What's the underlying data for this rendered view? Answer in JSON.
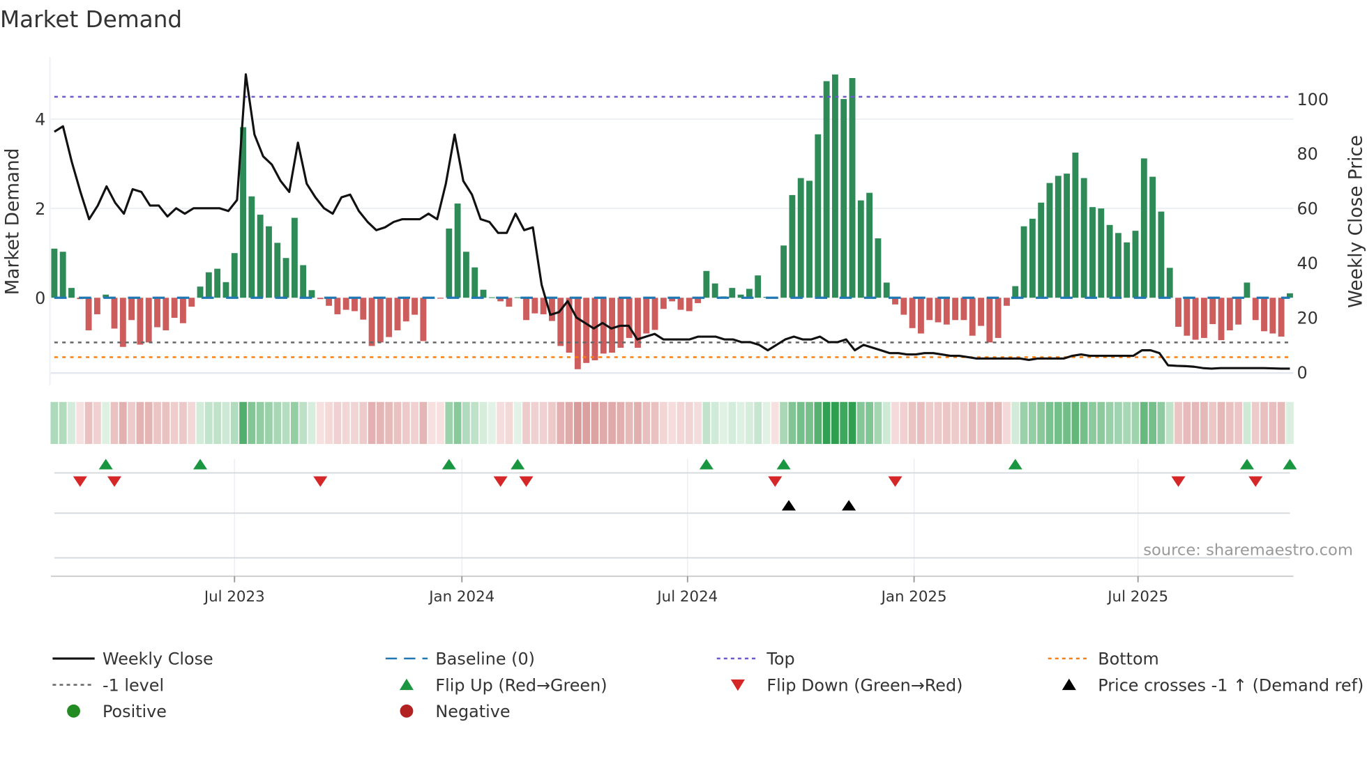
{
  "chart_data": {
    "type": "bar",
    "title": "Market Demand",
    "ylabel": "Market Demand",
    "y2label": "Weekly Close Price",
    "ylim": [
      -1.75,
      5.2
    ],
    "y2lim": [
      0,
      107
    ],
    "yticks": [
      "0",
      "2",
      "4"
    ],
    "y2ticks": [
      "0",
      "20",
      "40",
      "60",
      "80",
      "100"
    ],
    "xticks": [
      "Jul 2023",
      "Jan 2024",
      "Jul 2024",
      "Jan 2025",
      "Jul 2025"
    ],
    "xtick_week_index": [
      22,
      48.5,
      74.8,
      101.2,
      127.3
    ],
    "levels": {
      "baseline": 0,
      "top": 4.5,
      "minus_one": -1,
      "bottom": -1.33
    },
    "demand": [
      1.1,
      1.03,
      0.22,
      -0.03,
      -0.73,
      -0.37,
      0.07,
      -0.69,
      -1.1,
      -0.5,
      -1.05,
      -1.0,
      -0.66,
      -0.73,
      -0.45,
      -0.57,
      -0.2,
      0.25,
      0.57,
      0.65,
      0.35,
      1.0,
      3.82,
      2.27,
      1.86,
      1.6,
      1.23,
      0.89,
      1.79,
      0.73,
      0.17,
      -0.03,
      -0.18,
      -0.37,
      -0.27,
      -0.3,
      -0.49,
      -1.08,
      -1.0,
      -0.88,
      -0.73,
      -0.53,
      -0.38,
      -0.97,
      -0.02,
      -0.02,
      1.55,
      2.11,
      1.03,
      0.68,
      0.18,
      0.01,
      -0.08,
      -0.2,
      0.01,
      -0.5,
      -0.35,
      -0.37,
      -0.52,
      -1.08,
      -1.23,
      -1.6,
      -1.46,
      -1.4,
      -1.25,
      -1.23,
      -1.12,
      -0.9,
      -1.12,
      -0.8,
      -0.72,
      -0.25,
      -0.08,
      -0.27,
      -0.3,
      -0.12,
      0.6,
      0.32,
      0.03,
      0.22,
      0.07,
      0.2,
      0.5,
      0.02,
      -0.02,
      1.17,
      2.3,
      2.68,
      2.62,
      3.66,
      4.85,
      5.0,
      4.45,
      4.92,
      2.18,
      2.35,
      1.33,
      0.34,
      -0.15,
      -0.38,
      -0.68,
      -0.8,
      -0.5,
      -0.55,
      -0.6,
      -0.5,
      -0.5,
      -0.85,
      -0.63,
      -1.0,
      -0.9,
      -0.18,
      0.26,
      1.6,
      1.77,
      2.13,
      2.57,
      2.73,
      2.78,
      3.25,
      2.68,
      2.03,
      2.0,
      1.63,
      1.45,
      1.24,
      1.5,
      3.12,
      2.71,
      1.93,
      0.67,
      -0.65,
      -0.85,
      -0.94,
      -0.9,
      -0.59,
      -0.95,
      -0.73,
      -0.6,
      0.34,
      -0.5,
      -0.75,
      -0.8,
      -0.87,
      0.1
    ],
    "weekly_close": [
      88,
      90,
      77,
      66,
      56,
      61,
      68,
      62,
      58,
      67,
      66,
      61,
      61,
      57,
      60,
      58,
      60,
      60,
      60,
      60,
      59,
      63,
      109,
      87,
      79,
      76,
      70,
      66,
      84,
      69,
      64,
      60,
      58,
      64,
      65,
      59,
      55,
      52,
      53,
      55,
      56,
      56,
      56,
      58,
      56,
      69,
      87,
      70,
      65,
      56,
      55,
      51,
      51,
      58,
      52,
      53,
      32,
      21,
      22,
      26,
      20,
      18,
      16,
      18,
      16,
      17,
      17,
      12,
      13,
      14,
      12,
      12,
      12,
      12,
      13,
      13,
      13,
      12,
      12,
      11,
      11,
      10,
      8,
      10,
      12,
      13,
      12,
      12,
      13,
      11,
      11,
      12,
      8,
      10,
      9,
      8,
      7,
      7,
      6.5,
      6.5,
      7,
      7,
      6.5,
      6,
      6,
      5.5,
      5,
      5,
      5,
      5,
      5,
      5,
      4.5,
      5,
      5,
      5,
      5,
      6,
      6.5,
      6,
      6,
      6,
      6,
      6,
      6,
      8,
      8,
      7,
      2.5,
      2.3,
      2.2,
      2,
      1.5,
      1.3,
      1.5,
      1.5,
      1.5,
      1.5,
      1.5,
      1.5,
      1.4,
      1.3,
      1.3
    ],
    "flip_up_weeks": [
      7,
      18,
      47,
      55,
      77,
      86,
      113,
      140,
      145
    ],
    "flip_down_weeks": [
      4,
      8,
      32,
      53,
      56,
      85,
      99,
      132,
      141
    ],
    "price_cross_weeks": [
      86.6,
      93.6
    ],
    "legend_placement": "bottom",
    "legend": [
      {
        "label": "Weekly Close",
        "style": "line",
        "color": "#111111"
      },
      {
        "label": "Baseline (0)",
        "style": "dash",
        "color": "#1f77b4"
      },
      {
        "label": "Top",
        "style": "dot",
        "color": "#6a5acd"
      },
      {
        "label": "Bottom",
        "style": "dot",
        "color": "#ff7f0e"
      },
      {
        "label": "-1 level",
        "style": "dot",
        "color": "#666666"
      },
      {
        "label": "Flip Up (Red→Green)",
        "style": "tri-up",
        "color": "#1a9641"
      },
      {
        "label": "Flip Down (Green→Red)",
        "style": "tri-down",
        "color": "#d62728"
      },
      {
        "label": "Price crosses -1 ↑ (Demand ref)",
        "style": "tri-up",
        "color": "#000000"
      },
      {
        "label": "Positive",
        "style": "circle",
        "color": "#228b22"
      },
      {
        "label": "Negative",
        "style": "circle",
        "color": "#b22222"
      }
    ],
    "colors": {
      "positive_bar": "#2e8b57",
      "negative_bar": "#cd5c5c"
    },
    "source": "source: sharemaestro.com"
  }
}
